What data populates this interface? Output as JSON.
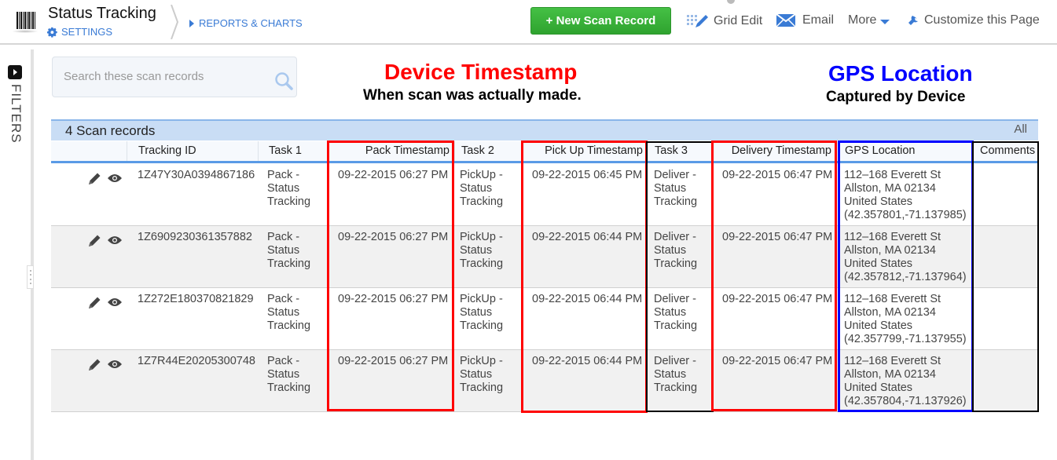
{
  "header": {
    "app_title": "Status Tracking",
    "settings_label": "SETTINGS",
    "reports_label": "REPORTS & CHARTS",
    "new_record_label": "+ New Scan Record",
    "grid_edit_label": "Grid Edit",
    "email_label": "Email",
    "more_label": "More",
    "customize_label": "Customize this Page"
  },
  "sidebar": {
    "filters_label": "FILTERS"
  },
  "search": {
    "placeholder": "Search these scan records",
    "value": ""
  },
  "annotations": {
    "device_title": "Device Timestamp",
    "device_sub": "When scan was actually made.",
    "gps_title": "GPS Location",
    "gps_sub": "Captured by Device",
    "colors": {
      "timestamp_box": "#ff0000",
      "gps_box": "#0000ff",
      "other_box": "#000000"
    }
  },
  "grid": {
    "records_count": "4 Scan records",
    "all_label": "All",
    "columns": [
      "",
      "Tracking ID",
      "Task 1",
      "Pack Timestamp",
      "Task 2",
      "Pick Up Timestamp",
      "Task 3",
      "Delivery Timestamp",
      "GPS Location",
      "Comments"
    ],
    "rows": [
      {
        "tracking_id": "1Z47Y30A0394867186",
        "task1": "Pack -\nStatus\nTracking",
        "pack_ts": "09-22-2015 06:27 PM",
        "task2": "PickUp -\nStatus\nTracking",
        "pickup_ts": "09-22-2015 06:45 PM",
        "task3": "Deliver -\nStatus\nTracking",
        "delivery_ts": "09-22-2015 06:47 PM",
        "gps": "112–168 Everett St\nAllston, MA  02134\nUnited States\n(42.357801,-71.137985)",
        "comments": ""
      },
      {
        "tracking_id": "1Z6909230361357882",
        "task1": "Pack -\nStatus\nTracking",
        "pack_ts": "09-22-2015 06:27 PM",
        "task2": "PickUp -\nStatus\nTracking",
        "pickup_ts": "09-22-2015 06:44 PM",
        "task3": "Deliver -\nStatus\nTracking",
        "delivery_ts": "09-22-2015 06:47 PM",
        "gps": "112–168 Everett St\nAllston, MA  02134\nUnited States\n(42.357812,-71.137964)",
        "comments": ""
      },
      {
        "tracking_id": "1Z272E180370821829",
        "task1": "Pack -\nStatus\nTracking",
        "pack_ts": "09-22-2015 06:27 PM",
        "task2": "PickUp -\nStatus\nTracking",
        "pickup_ts": "09-22-2015 06:44 PM",
        "task3": "Deliver -\nStatus\nTracking",
        "delivery_ts": "09-22-2015 06:47 PM",
        "gps": "112–168 Everett St\nAllston, MA  02134\nUnited States\n(42.357799,-71.137955)",
        "comments": ""
      },
      {
        "tracking_id": "1Z7R44E20205300748",
        "task1": "Pack -\nStatus\nTracking",
        "pack_ts": "09-22-2015 06:27 PM",
        "task2": "PickUp -\nStatus\nTracking",
        "pickup_ts": "09-22-2015 06:44 PM",
        "task3": "Deliver -\nStatus\nTracking",
        "delivery_ts": "09-22-2015 06:47 PM",
        "gps": "112–168 Everett St\nAllston, MA  02134\nUnited States\n(42.357804,-71.137926)",
        "comments": ""
      }
    ]
  }
}
